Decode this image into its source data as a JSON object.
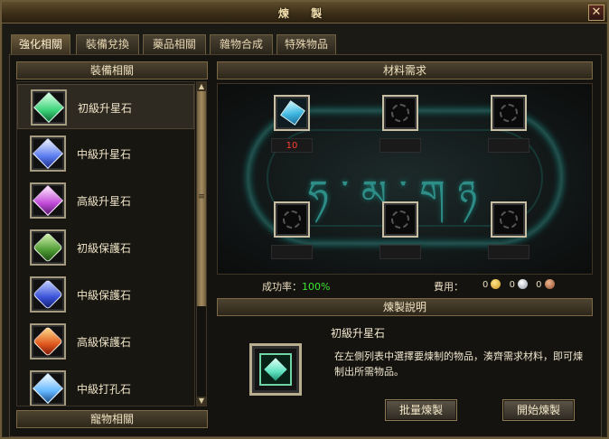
{
  "window": {
    "title": "煉 製",
    "close_glyph": "✕"
  },
  "tabs": [
    {
      "label": "強化相關",
      "active": true
    },
    {
      "label": "裝備兌換",
      "active": false
    },
    {
      "label": "藥品相關",
      "active": false
    },
    {
      "label": "雜物合成",
      "active": false
    },
    {
      "label": "特殊物品",
      "active": false
    }
  ],
  "left": {
    "header": "裝備相關",
    "footer_header": "寵物相關",
    "items": [
      {
        "label": "初級升星石",
        "icon": "green-diamond-icon",
        "color": "#3cd47a",
        "selected": true
      },
      {
        "label": "中級升星石",
        "icon": "blue-diamond-icon",
        "color": "#5a7cf0",
        "selected": false
      },
      {
        "label": "高級升星石",
        "icon": "purple-diamond-icon",
        "color": "#c24ad9",
        "selected": false
      },
      {
        "label": "初級保護石",
        "icon": "green-guard-stone-icon",
        "color": "#4d9a34",
        "selected": false
      },
      {
        "label": "中級保護石",
        "icon": "blue-guard-stone-icon",
        "color": "#3a52d8",
        "selected": false
      },
      {
        "label": "高級保護石",
        "icon": "red-guard-stone-icon",
        "color": "#e0571e",
        "selected": false
      },
      {
        "label": "中級打孔石",
        "icon": "ice-crystal-icon",
        "color": "#63b7ff",
        "selected": false
      }
    ],
    "scroll_up": "▲",
    "scroll_down": "▼",
    "scroll_grip": "≡"
  },
  "materials": {
    "header": "材料需求",
    "rune_text": "ཧ་མ་གཉ",
    "slots": [
      {
        "filled": true,
        "icon": "crystal-material-icon",
        "count": "10"
      },
      {
        "filled": false,
        "icon": "empty-socket-icon",
        "count": ""
      },
      {
        "filled": false,
        "icon": "empty-socket-icon",
        "count": ""
      },
      {
        "filled": false,
        "icon": "empty-socket-icon",
        "count": ""
      },
      {
        "filled": false,
        "icon": "empty-socket-icon",
        "count": ""
      },
      {
        "filled": false,
        "icon": "empty-socket-icon",
        "count": ""
      }
    ]
  },
  "stats": {
    "success_label": "成功率：",
    "success_value": "100%",
    "fee_label": "費用：",
    "gold": "0",
    "silver": "0",
    "copper": "0"
  },
  "description": {
    "header": "煉製說明",
    "product_name": "初級升星石",
    "text": "在左側列表中選擇要煉制的物品，湊齊需求材料，即可煉制出所需物品。"
  },
  "buttons": {
    "batch": "批量煉製",
    "start": "開始煉製"
  }
}
